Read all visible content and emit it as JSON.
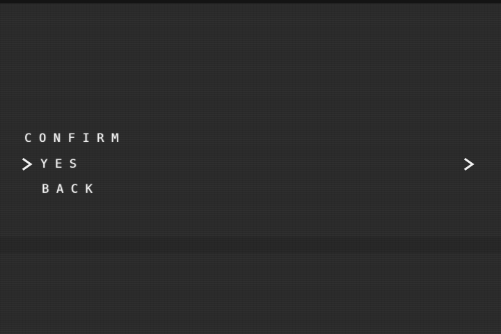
{
  "menu": {
    "title": "CONFIRM",
    "items": [
      {
        "label": "YES",
        "selected": true,
        "has_submenu": true
      },
      {
        "label": "BACK",
        "selected": false,
        "has_submenu": false
      }
    ]
  },
  "icons": {
    "cursor": "chevron-right-icon",
    "submenu": "chevron-right-icon"
  },
  "colors": {
    "text": "#f2f2f2",
    "background": "#2a2a2a"
  }
}
